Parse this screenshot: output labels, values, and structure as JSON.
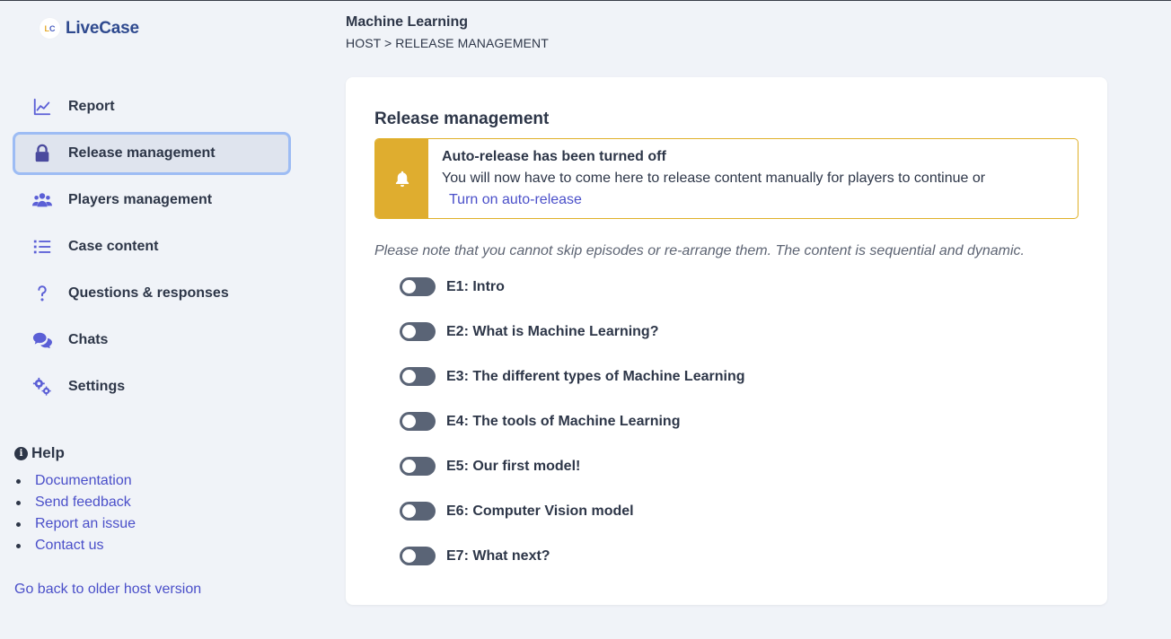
{
  "app": {
    "name": "LiveCase",
    "logo_mark_left": "L",
    "logo_mark_right": "C"
  },
  "header": {
    "title": "Machine Learning",
    "breadcrumb": "HOST > RELEASE MANAGEMENT"
  },
  "sidebar": {
    "items": [
      {
        "label": "Report",
        "icon": "chart-line-icon",
        "active": false
      },
      {
        "label": "Release management",
        "icon": "lock-icon",
        "active": true
      },
      {
        "label": "Players management",
        "icon": "users-icon",
        "active": false
      },
      {
        "label": "Case content",
        "icon": "list-icon",
        "active": false
      },
      {
        "label": "Questions & responses",
        "icon": "question-icon",
        "active": false
      },
      {
        "label": "Chats",
        "icon": "chat-bubbles-icon",
        "active": false
      },
      {
        "label": "Settings",
        "icon": "gears-icon",
        "active": false
      }
    ],
    "help": {
      "title": "Help",
      "links": [
        "Documentation",
        "Send feedback",
        "Report an issue",
        "Contact us"
      ]
    },
    "older_version_link": "Go back to older host version"
  },
  "main": {
    "title": "Release management",
    "alert": {
      "title": "Auto-release has been turned off",
      "text": "You will now have to come here to release content manually for players to continue or",
      "link": "Turn on auto-release",
      "color": "#dfad2f"
    },
    "note": "Please note that you cannot skip episodes or re-arrange them. The content is sequential and dynamic.",
    "episodes": [
      {
        "label": "E1: Intro",
        "released": false
      },
      {
        "label": "E2: What is Machine Learning?",
        "released": false
      },
      {
        "label": "E3: The different types of Machine Learning",
        "released": false
      },
      {
        "label": "E4: The tools of Machine Learning",
        "released": false
      },
      {
        "label": "E5: Our first model!",
        "released": false
      },
      {
        "label": "E6: Computer Vision model",
        "released": false
      },
      {
        "label": "E7: What next?",
        "released": false
      }
    ]
  },
  "colors": {
    "accent": "#5b5fd6",
    "link": "#4a4fc9",
    "active_border": "#9dbcf4",
    "toggle_off": "#5a6476"
  }
}
